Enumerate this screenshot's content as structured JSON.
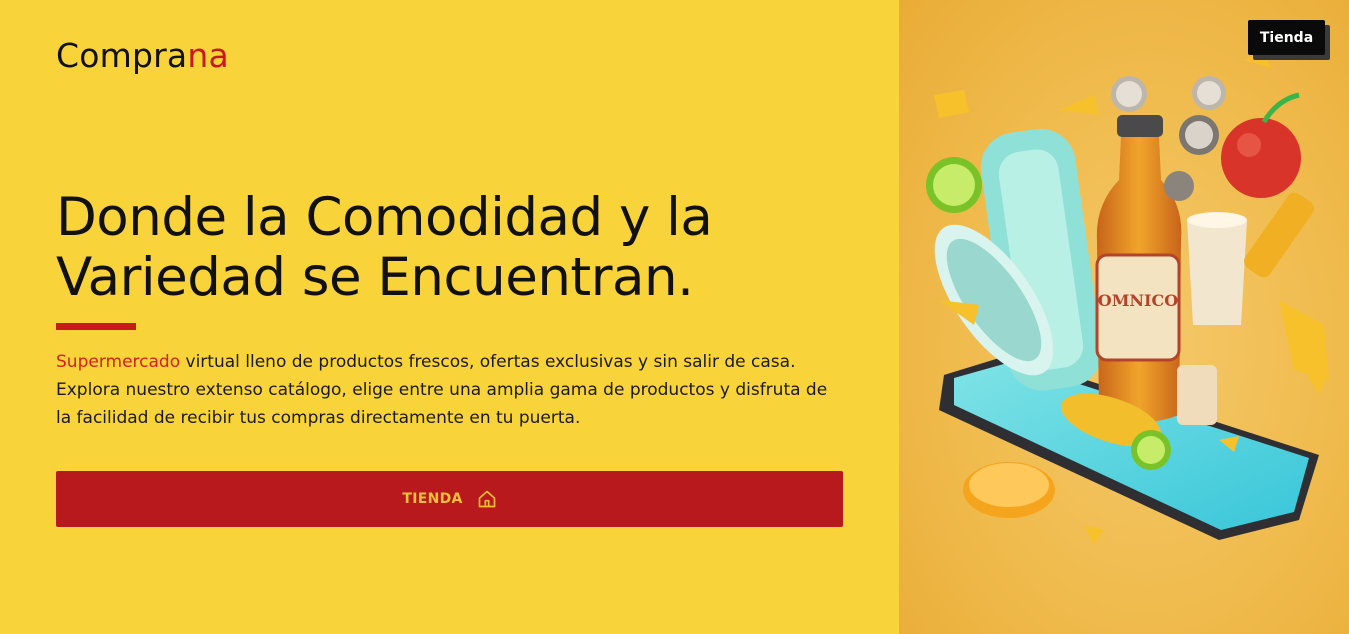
{
  "logo": {
    "part1": "Compra",
    "part2": "na"
  },
  "hero": {
    "headline": "Donde la Comodidad y la Variedad se Encuentran.",
    "description_highlight": "Supermercado",
    "description_rest": " virtual lleno de productos frescos, ofertas exclusivas y sin salir de casa. Explora nuestro extenso catálogo, elige entre una amplia gama de productos y disfruta de la facilidad de recibir tus compras directamente en tu puerta.",
    "cta_label": "TIENDA",
    "cta_icon": "home-icon"
  },
  "header": {
    "store_button_label": "Tienda"
  },
  "illustration": {
    "bottle_label": "OMNICO"
  },
  "colors": {
    "background": "#f9d33a",
    "accent": "#c8191c",
    "button": "#b7191c",
    "button_text": "#f2c232"
  }
}
